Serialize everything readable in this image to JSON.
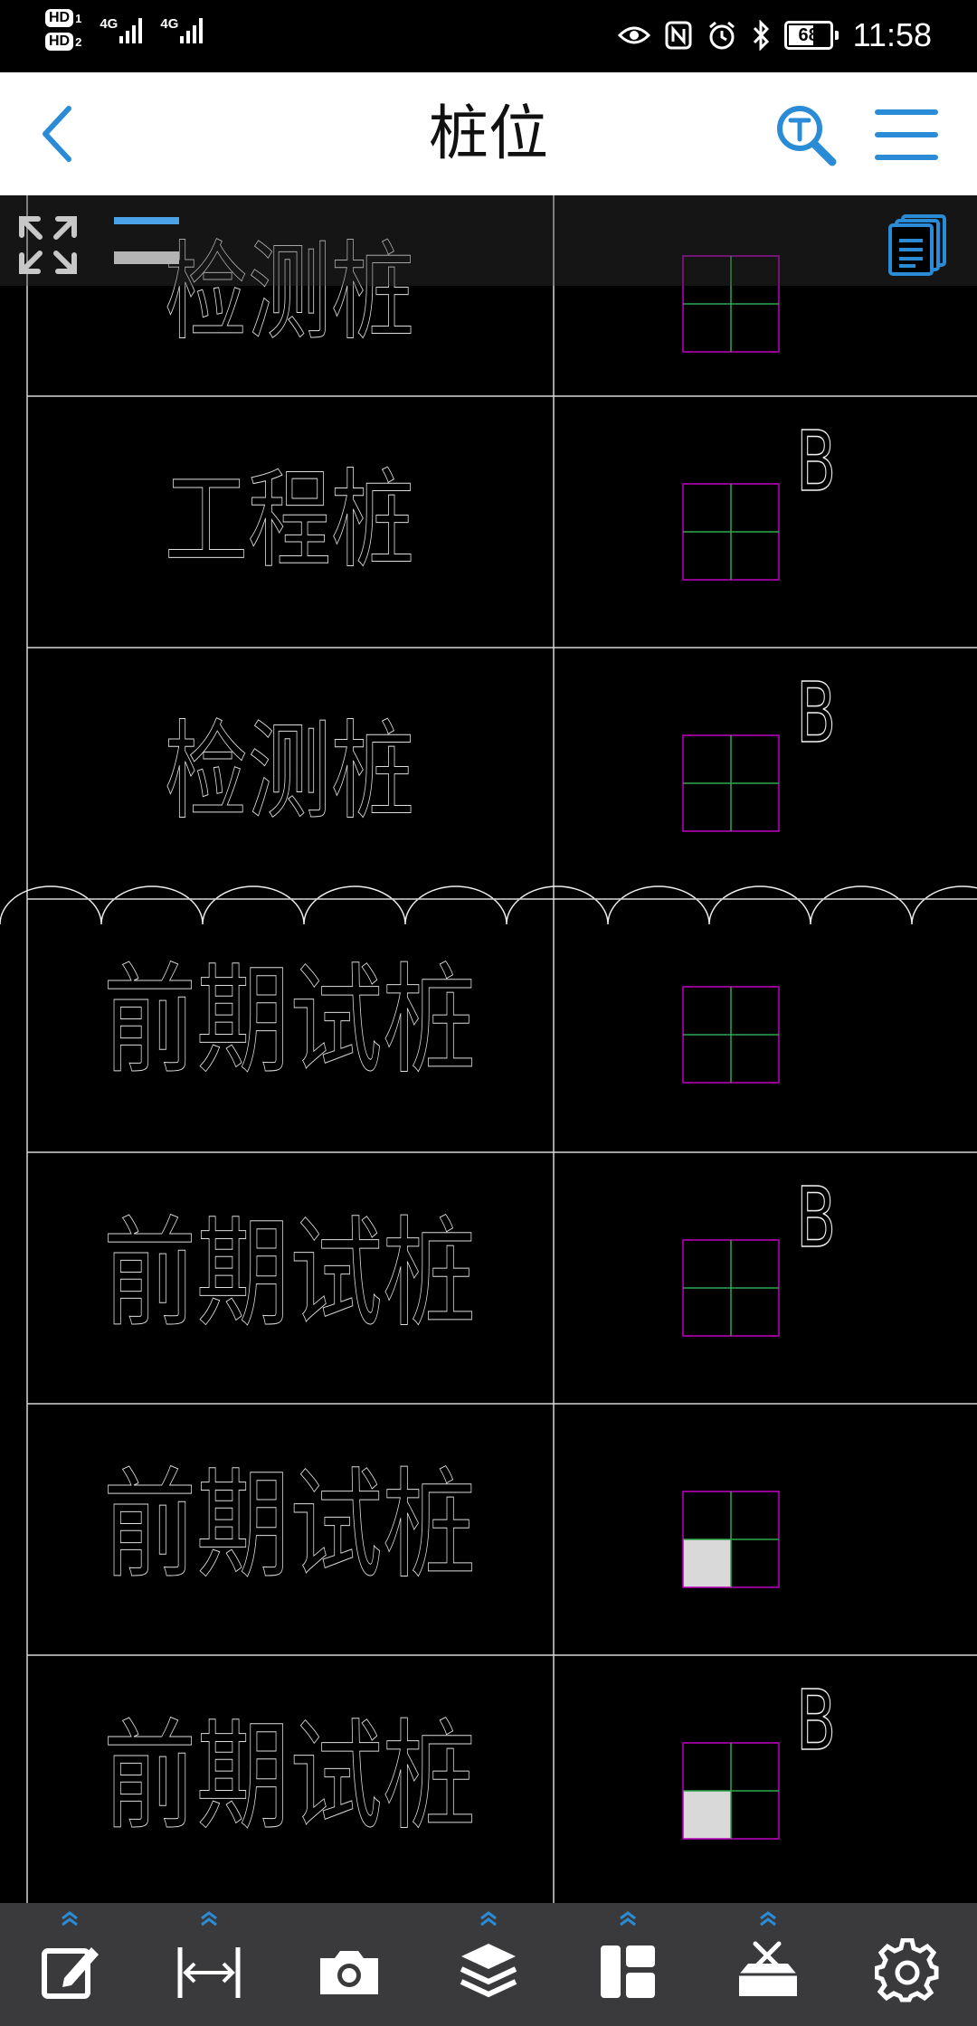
{
  "status_bar": {
    "sim1": "HD",
    "sim1_num": "1",
    "sim2": "HD",
    "sim2_num": "2",
    "net1": "4G",
    "net2": "4G",
    "battery_level": "68",
    "time": "11:58"
  },
  "header": {
    "title": "桩位",
    "back_icon": "chevron-left-icon",
    "text_search_icon": "text-search-icon",
    "menu_icon": "hamburger-menu-icon",
    "accent_color": "#2a8bd6"
  },
  "canvas_tools": {
    "expand_icon": "fullscreen-expand-icon",
    "toggle_icon": "panel-toggle-icon",
    "layouts_icon": "sheets-icon"
  },
  "drawing": {
    "rows": [
      {
        "label": "检测桩",
        "mark": "",
        "fill": false
      },
      {
        "label": "工程桩",
        "mark": "B",
        "fill": false
      },
      {
        "label": "检测桩",
        "mark": "B",
        "fill": false
      },
      {
        "label": "前期试桩",
        "mark": "",
        "fill": false
      },
      {
        "label": "前期试桩",
        "mark": "B",
        "fill": false
      },
      {
        "label": "前期试桩",
        "mark": "",
        "fill": true
      },
      {
        "label": "前期试桩",
        "mark": "B",
        "fill": true
      }
    ],
    "line_color": "#d8d8d8",
    "box_color": "#c000c0",
    "cross_color": "#2ea84a",
    "fill_color": "#d9d9d9",
    "revision_cloud_color": "#eeeeee"
  },
  "toolbar": {
    "items": [
      {
        "name": "edit-annotation-icon",
        "has_expander": true
      },
      {
        "name": "measure-icon",
        "has_expander": true
      },
      {
        "name": "camera-icon",
        "has_expander": false
      },
      {
        "name": "layers-icon",
        "has_expander": true
      },
      {
        "name": "layout-icon",
        "has_expander": true
      },
      {
        "name": "toolbox-icon",
        "has_expander": true
      },
      {
        "name": "settings-gear-icon",
        "has_expander": false
      }
    ],
    "icon_color": "#ffffff",
    "expander_color": "#2a8bd6"
  }
}
